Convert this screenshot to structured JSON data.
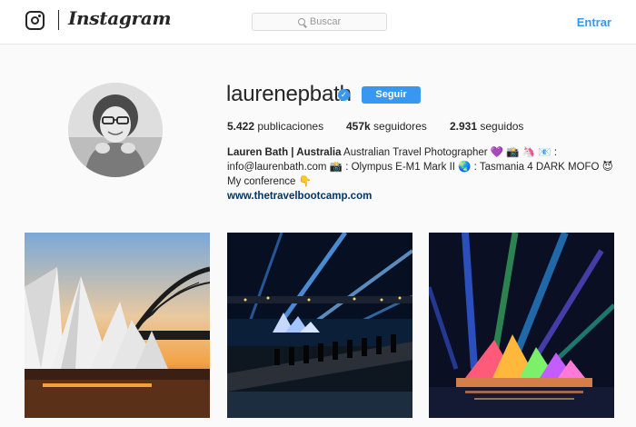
{
  "header": {
    "brand": "Instagram",
    "search_placeholder": "Buscar",
    "login_label": "Entrar"
  },
  "profile": {
    "username": "laurenepbath",
    "verified": "✓",
    "follow_label": "Seguir",
    "stats": {
      "posts_count": "5.422",
      "posts_label": "publicaciones",
      "followers_count": "457k",
      "followers_label": "seguidores",
      "following_count": "2.931",
      "following_label": "seguidos"
    },
    "bio_name": "Lauren Bath | Australia",
    "bio_text": "Australian Travel Photographer 💜 📸 🦄 📧 : info@laurenbath.com 📸 : Olympus E-M1 Mark II 🌏 : Tasmania 4 DARK MOFO 😈  My conference 👇",
    "website": "www.thetravelbootcamp.com"
  },
  "posts": [
    {
      "subject": "Sydney Opera House and Harbour Bridge at sunset"
    },
    {
      "subject": "Vivid Sydney lasers over harbour at night"
    },
    {
      "subject": "Opera House illuminated with colourful lights"
    }
  ],
  "colors": {
    "accent": "#3897f0",
    "link": "#003569",
    "text": "#262626",
    "background": "#fafafa"
  }
}
